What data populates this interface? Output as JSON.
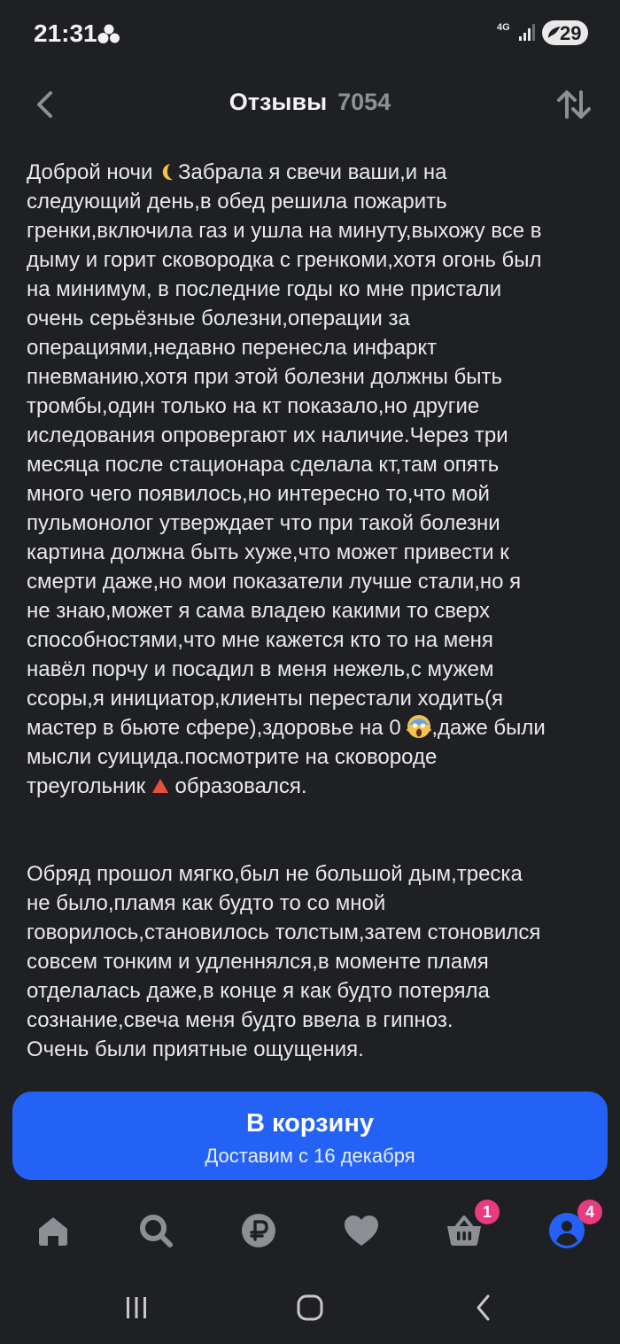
{
  "status_bar": {
    "time": "21:31",
    "network": "4G",
    "battery": "29"
  },
  "header": {
    "title": "Отзывы",
    "count": "7054"
  },
  "review": {
    "paragraph1": "Доброй ночи 🌙Забрала я свечи ваши,и на\nследующий день,в обед решила пожарить\nгренки,включила газ и ушла на минуту,выхожу все в\nдыму и горит сковородка с гренкоми,хотя огонь был\nна минимум, в последние годы ко мне пристали\nочень серьёзные болезни,операции за\nоперациями,недавно перенесла инфаркт\nпневманию,хотя при этой болезни должны быть\nтромбы,один только на кт показало,но другие\nиследования опровергают их наличие.Через три\nмесяца после стационара сделала кт,там опять\nмного чего появилось,но интересно то,что мой\nпульмонолог утверждает что при такой болезни\nкартина должна быть хуже,что может привести к\nсмерти даже,но мои показатели лучше стали,но я\nне знаю,может я сама владею какими то сверх\nспособностями,что мне кажется кто то на меня\nнавёл порчу и посадил в меня нежель,с мужем\nссоры,я инициатор,клиенты перестали ходить(я\nмастер в бьюте сфере),здоровье на 0 😱,даже были\nмысли суицида.посмотрите на сковороде\nтреугольник 🔺 образовался.",
    "paragraph2": "Обряд прошол мягко,был не большой  дым,треска\nне было,пламя как будто то со мной\nговорилось,становилось толстым,затем стоновился\nсовсем тонким и удленнялся,в моменте пламя\nотделалась даже,в конце я как будто потеряла\nсознание,свеча меня будто ввела в гипноз.\nОчень были приятные ощущения."
  },
  "cart": {
    "label": "В корзину",
    "delivery": "Доставим с 16 декабря"
  },
  "bottom_nav": {
    "items": [
      {
        "icon": "home-icon"
      },
      {
        "icon": "search-icon"
      },
      {
        "icon": "ruble-icon"
      },
      {
        "icon": "heart-icon"
      },
      {
        "icon": "basket-icon",
        "badge": "1"
      },
      {
        "icon": "profile-icon",
        "badge": "4"
      }
    ]
  },
  "colors": {
    "background": "#1f2023",
    "accent": "#2462f5",
    "badge": "#e93b80",
    "icon_muted": "#8e8f94"
  }
}
